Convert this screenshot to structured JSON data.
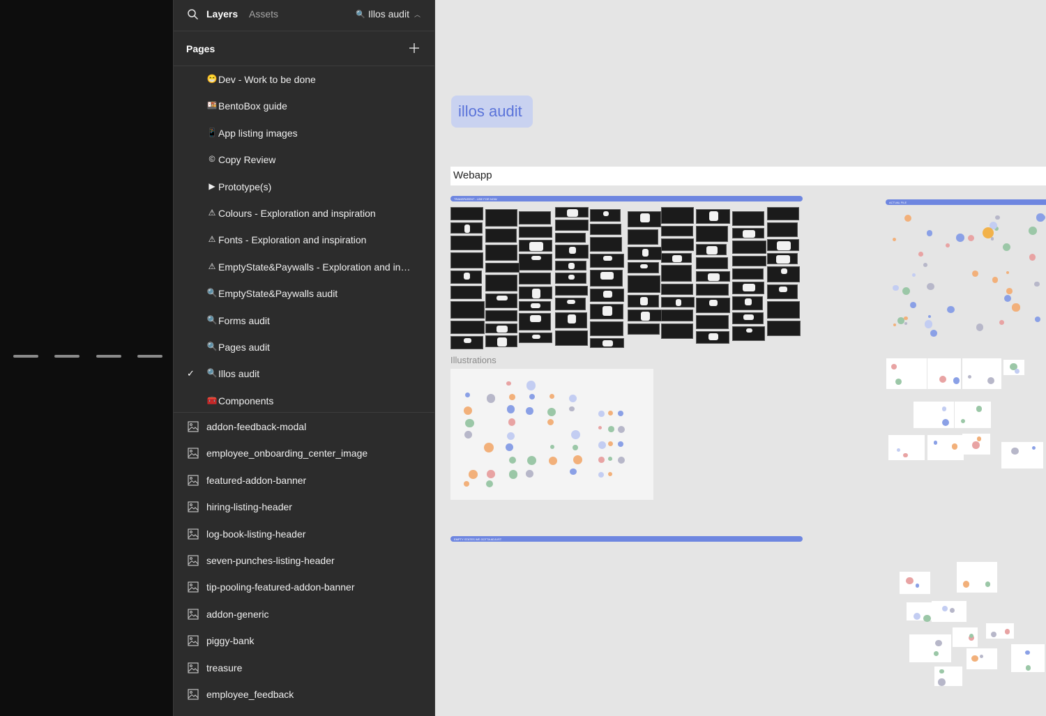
{
  "header": {
    "tab_layers": "Layers",
    "tab_assets": "Assets",
    "current_page": "Illos audit"
  },
  "pages": {
    "title": "Pages",
    "items": [
      {
        "icon": "😁",
        "label": "Dev - Work to be done",
        "selected": false
      },
      {
        "icon": "🍱",
        "label": "BentoBox guide",
        "selected": false
      },
      {
        "icon": "📱",
        "label": "App listing images",
        "selected": false
      },
      {
        "icon": "©",
        "label": "Copy Review",
        "selected": false
      },
      {
        "icon": "▶",
        "label": "Prototype(s)",
        "selected": false
      },
      {
        "icon": "⚠",
        "label": "Colours - Exploration and inspiration",
        "selected": false
      },
      {
        "icon": "⚠",
        "label": "Fonts - Exploration and inspiration",
        "selected": false
      },
      {
        "icon": "⚠",
        "label": "EmptyState&Paywalls - Exploration and ins...",
        "selected": false
      },
      {
        "icon": "🔍",
        "label": "EmptyState&Paywalls audit",
        "selected": false
      },
      {
        "icon": "🔍",
        "label": "Forms audit",
        "selected": false
      },
      {
        "icon": "🔍",
        "label": "Pages audit",
        "selected": false
      },
      {
        "icon": "🔍",
        "label": "Illos audit",
        "selected": true
      },
      {
        "icon": "🧰",
        "label": "Components",
        "selected": false
      }
    ]
  },
  "layers": [
    "addon-feedback-modal",
    "employee_onboarding_center_image",
    "featured-addon-banner",
    "hiring-listing-header",
    "log-book-listing-header",
    "seven-punches-listing-header",
    "tip-pooling-featured-addon-banner",
    "addon-generic",
    "piggy-bank",
    "treasure",
    "employee_feedback"
  ],
  "canvas": {
    "section_title": "illos audit",
    "webapp_title": "Webapp",
    "illustrations_label": "Illustrations",
    "strip_1": "TRANSPARENT - USE FOR NOW",
    "strip_2": "ACTUAL FILE",
    "strip_3": "EMPTY STATES WE GOTTA ADJUST"
  },
  "colors": {
    "panel_bg": "#2c2c2c",
    "canvas_bg": "#e5e5e5",
    "accent_blue": "#6e86e0",
    "badge_bg": "#c9d2f0",
    "badge_text": "#5a73d9"
  }
}
